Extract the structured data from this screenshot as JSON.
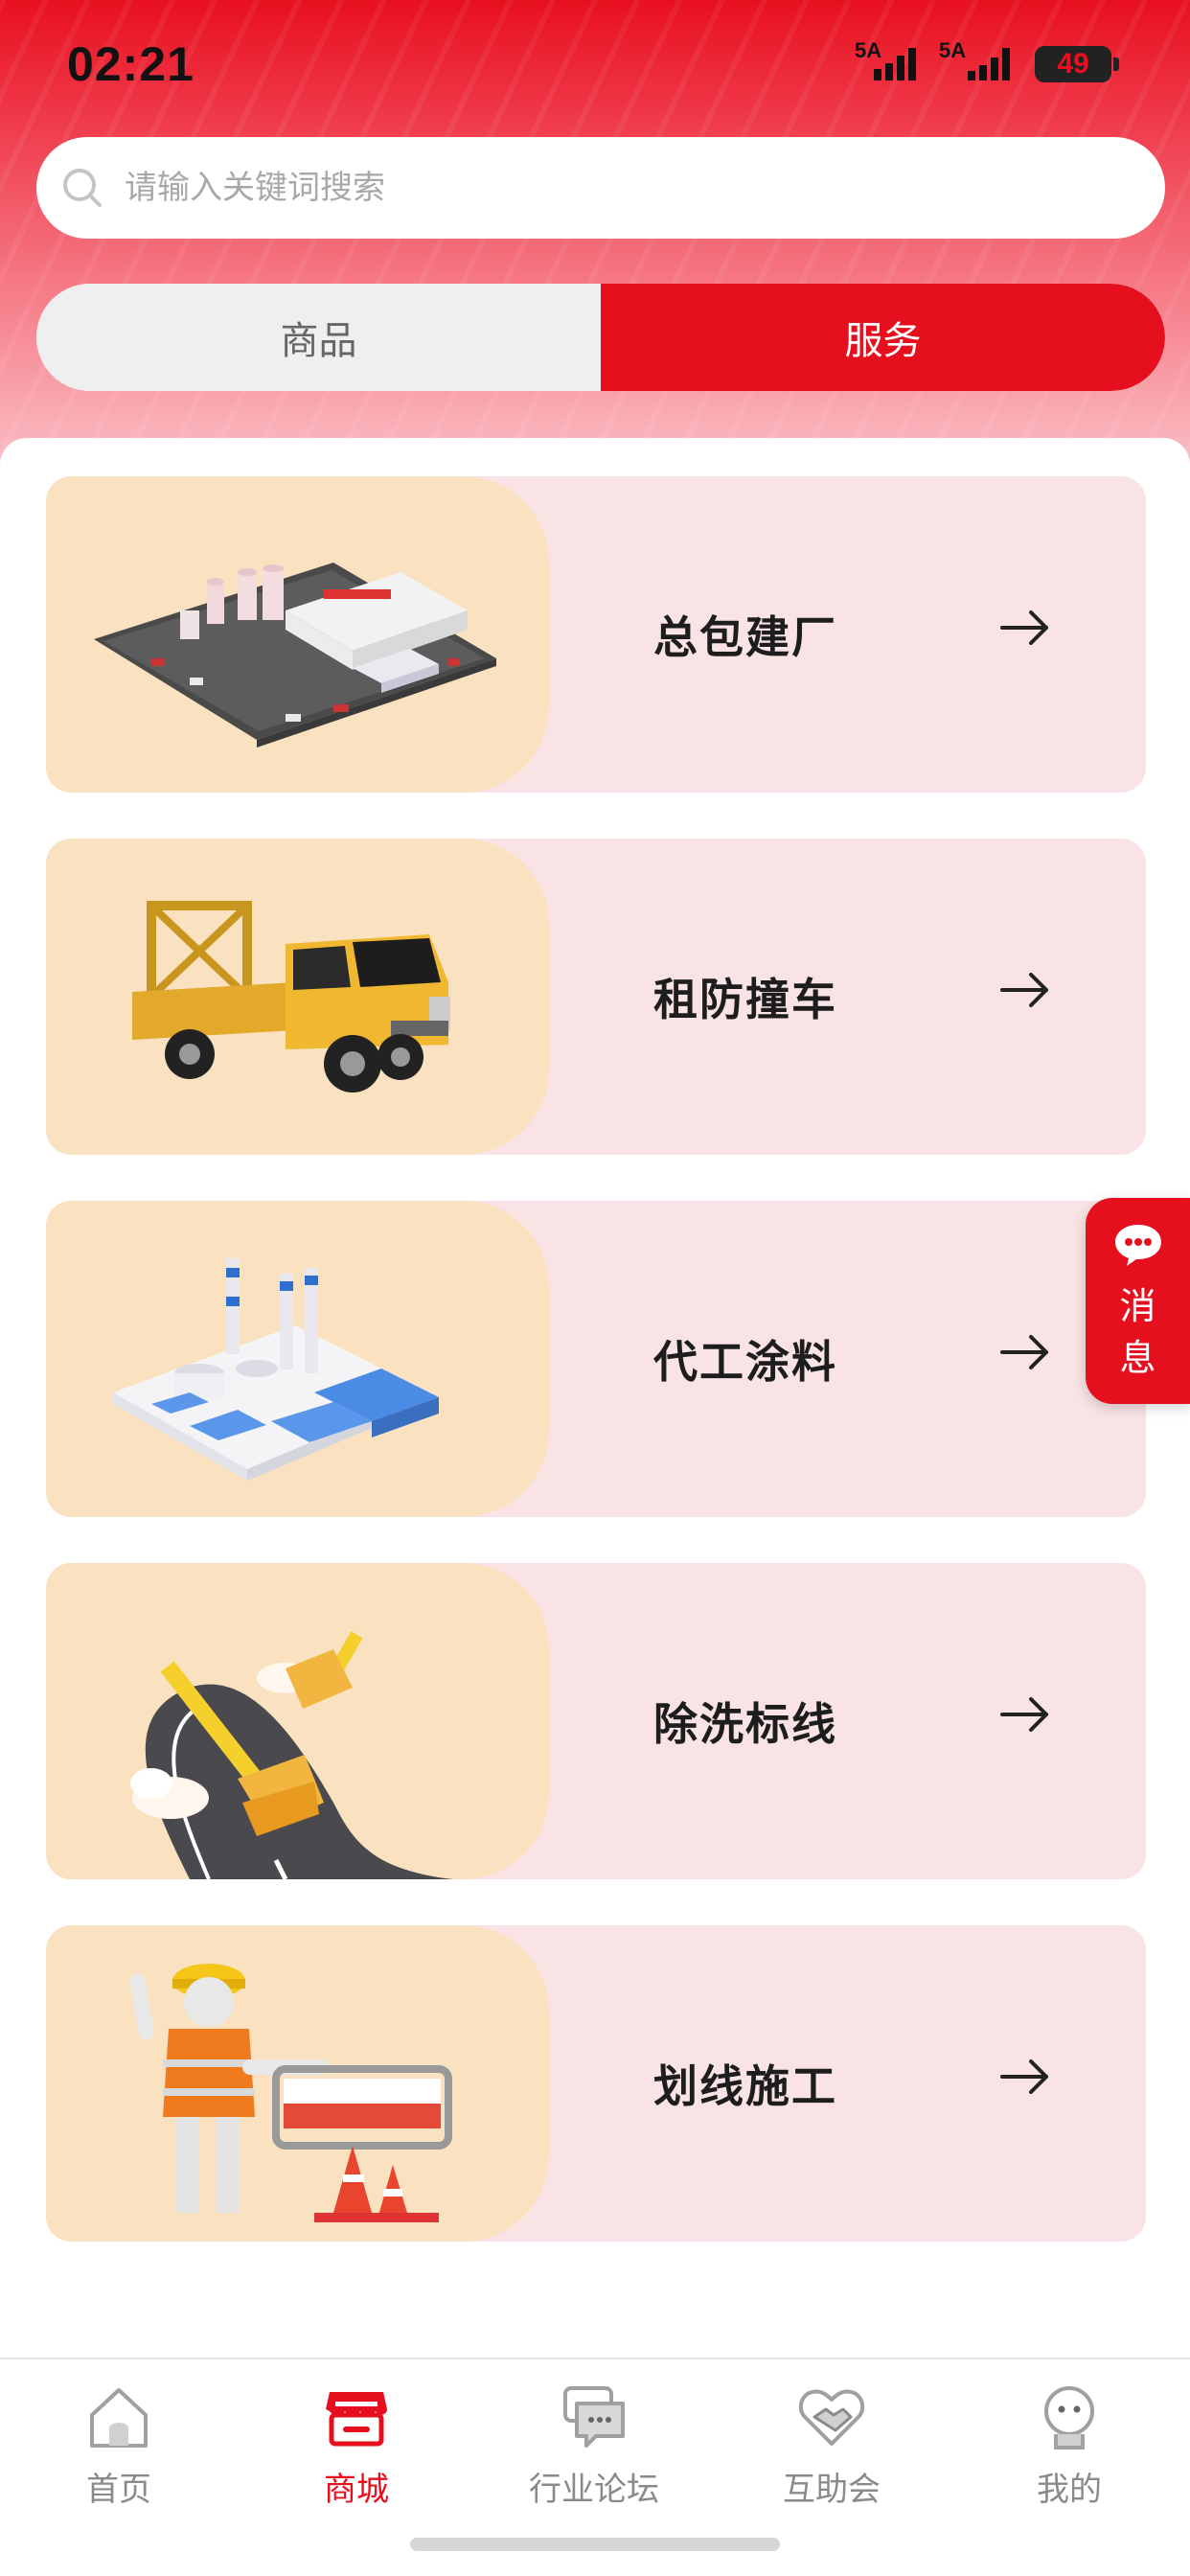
{
  "status_bar": {
    "time": "02:21",
    "signal1_label": "5A",
    "signal2_label": "5A",
    "battery": "49"
  },
  "search": {
    "placeholder": "请输入关键词搜索",
    "icon": "search-icon"
  },
  "segment": {
    "tabs": [
      {
        "label": "商品",
        "active": false
      },
      {
        "label": "服务",
        "active": true
      }
    ]
  },
  "services": [
    {
      "title": "总包建厂",
      "icon": "factory-illustration"
    },
    {
      "title": "租防撞车",
      "icon": "crash-truck-illustration"
    },
    {
      "title": "代工涂料",
      "icon": "chemical-plant-illustration"
    },
    {
      "title": "除洗标线",
      "icon": "road-brush-illustration"
    },
    {
      "title": "划线施工",
      "icon": "road-worker-illustration"
    }
  ],
  "floating_message": {
    "label_line1": "消",
    "label_line2": "息",
    "icon": "chat-bubble-icon"
  },
  "bottom_nav": {
    "items": [
      {
        "label": "首页",
        "icon": "home-icon",
        "active": false
      },
      {
        "label": "商城",
        "icon": "shop-icon",
        "active": true
      },
      {
        "label": "行业论坛",
        "icon": "forum-icon",
        "active": false
      },
      {
        "label": "互助会",
        "icon": "handshake-icon",
        "active": false
      },
      {
        "label": "我的",
        "icon": "profile-icon",
        "active": false
      }
    ]
  },
  "colors": {
    "brand_red": "#e60f1e",
    "card_bg": "#f9e3e4",
    "image_bg": "#fae1bf",
    "inactive_gray": "#8a8a8a"
  }
}
